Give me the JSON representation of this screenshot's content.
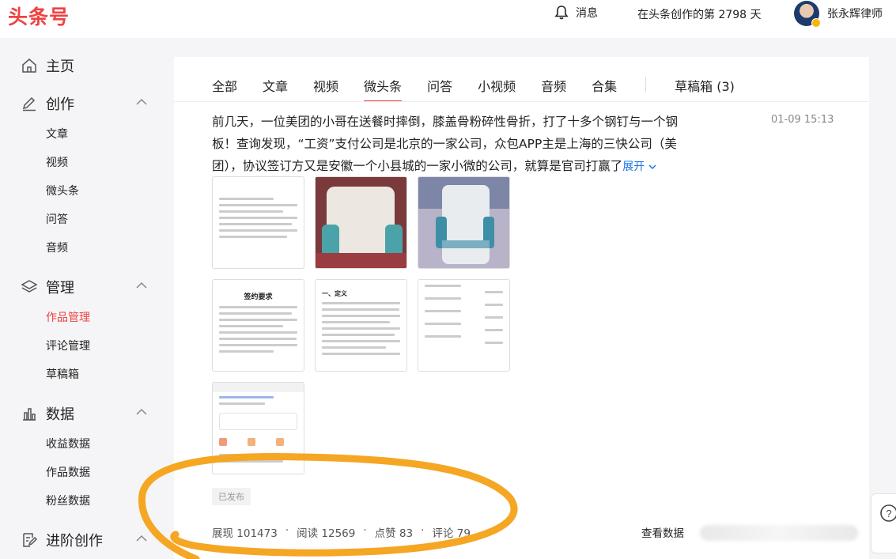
{
  "header": {
    "logo": "头条号",
    "messages_label": "消息",
    "creation_days_text": "在头条创作的第 2798 天",
    "username": "张永辉律师"
  },
  "sidebar": {
    "home": "主页",
    "create": {
      "label": "创作",
      "items": [
        "文章",
        "视频",
        "微头条",
        "问答",
        "音频"
      ]
    },
    "manage": {
      "label": "管理",
      "items": [
        "作品管理",
        "评论管理",
        "草稿箱"
      ],
      "active": "作品管理"
    },
    "data": {
      "label": "数据",
      "items": [
        "收益数据",
        "作品数据",
        "粉丝数据"
      ]
    },
    "advanced": "进阶创作"
  },
  "tabs": [
    "全部",
    "文章",
    "视频",
    "微头条",
    "问答",
    "小视频",
    "音频",
    "合集"
  ],
  "active_tab": "微头条",
  "drafts_tab": "草稿箱 (3)",
  "post": {
    "text": "前几天，一位美团的小哥在送餐时摔倒，膝盖骨粉碎性骨折，打了十多个钢钉与一个钢板！查询发现，“工资”支付公司是北京的一家公司，众包APP主是上海的三快公司（美团），协议签订方又是安徽一个小县城的一家小微的公司，就算是官司打赢了",
    "expand": "展开",
    "time": "01-09 15:13",
    "images": {
      "doc1_title": "签约要求",
      "doc2_heading": "一、定义"
    },
    "status": "已发布",
    "stats": [
      "展现 101473",
      "阅读 12569",
      "点赞 83",
      "评论 79"
    ],
    "view_data": "查看数据"
  },
  "colors": {
    "brand": "#f04142",
    "link": "#1a73e8",
    "annotation": "#f5a623"
  }
}
